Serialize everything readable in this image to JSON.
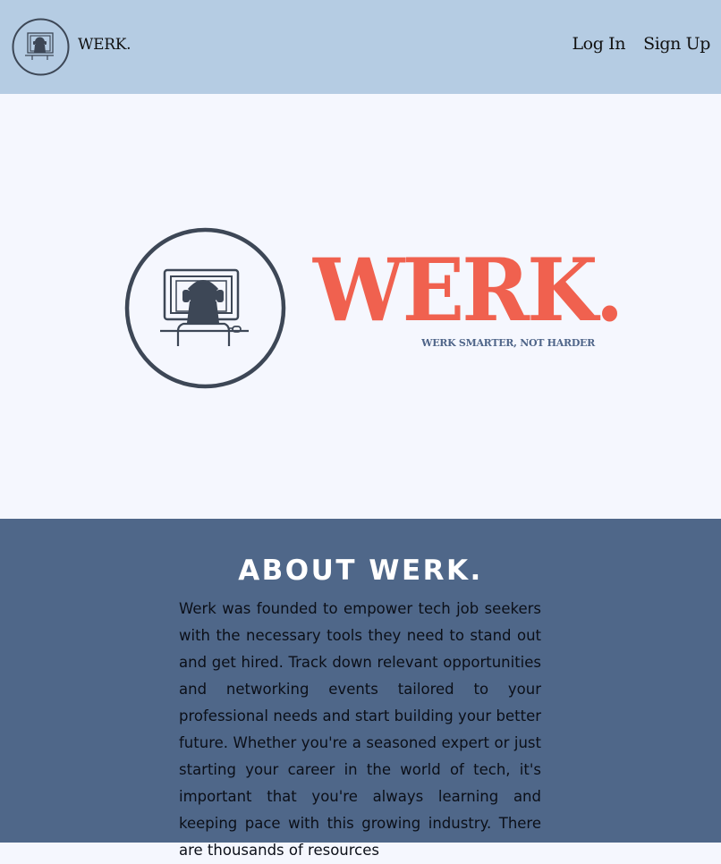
{
  "navbar": {
    "brand": "WERK.",
    "links": {
      "login": "Log In",
      "signup": "Sign Up"
    },
    "logo_icon": "computer-user-icon"
  },
  "hero": {
    "wordmark": "WERK.",
    "tagline": "WERK SMARTER, NOT HARDER",
    "logo_icon": "computer-user-icon"
  },
  "about": {
    "title": "ABOUT WERK.",
    "body": "Werk was founded to empower tech job seekers with the necessary tools they need to stand out and get hired. Track down relevant opportunities and networking events tailored to your professional needs and start building your better future. Whether you're a seasoned expert or just starting your career in the world of tech, it's important that you're always learning and keeping pace with this growing industry. There are thousands of resources"
  },
  "colors": {
    "nav_bg": "#b5cce3",
    "hero_bg": "#f5f7fe",
    "accent": "#f0614f",
    "about_bg": "#4f6789",
    "icon_dark": "#3d4756"
  }
}
